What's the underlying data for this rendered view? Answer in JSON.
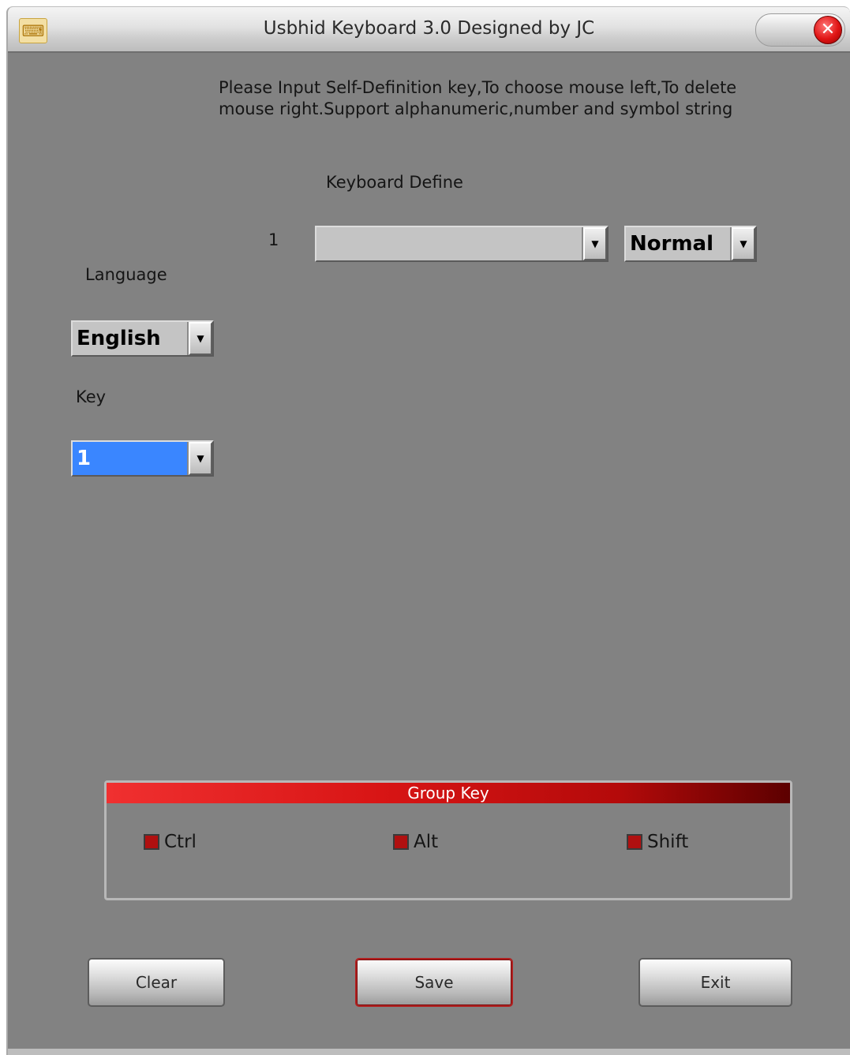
{
  "window": {
    "title": "Usbhid Keyboard 3.0 Designed by JC",
    "close_symbol": "✕",
    "app_icon": "keyboard-app-icon"
  },
  "instruction": "Please Input Self-Definition key,To choose mouse left,To delete mouse right.Support alphanumeric,number and symbol string",
  "keyboard_define": {
    "label": "Keyboard Define",
    "row_number": "1",
    "key_value": "",
    "mode_value": "Normal"
  },
  "language": {
    "label": "Language",
    "value": "English"
  },
  "key": {
    "label": "Key",
    "value": "1"
  },
  "group_key": {
    "title": "Group Key",
    "options": [
      {
        "label": "Ctrl",
        "checked": false
      },
      {
        "label": "Alt",
        "checked": false
      },
      {
        "label": "Shift",
        "checked": false
      }
    ]
  },
  "buttons": {
    "clear": "Clear",
    "save": "Save",
    "exit": "Exit"
  },
  "colors": {
    "background": "#828282",
    "accent": "#d81515",
    "selection": "#3a86ff"
  },
  "icons": {
    "dropdown": "dropdown-arrow-icon",
    "close": "close-icon"
  }
}
